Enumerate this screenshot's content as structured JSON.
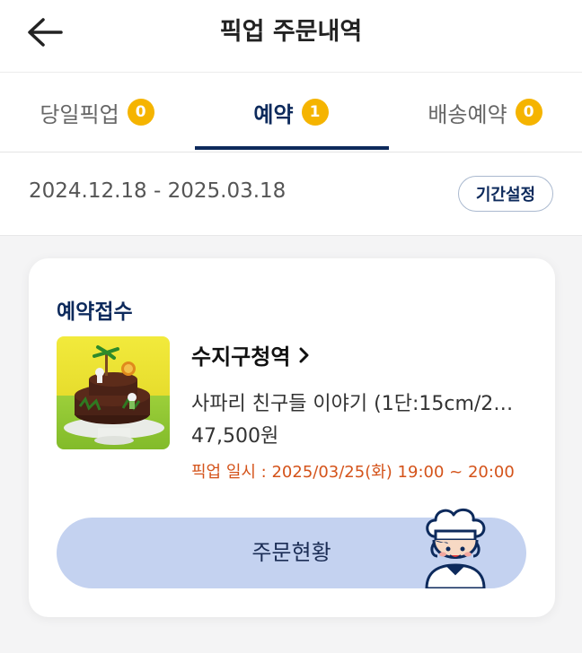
{
  "header": {
    "title": "픽업 주문내역"
  },
  "tabs": [
    {
      "label": "당일픽업",
      "count": "0",
      "active": false
    },
    {
      "label": "예약",
      "count": "1",
      "active": true
    },
    {
      "label": "배송예약",
      "count": "0",
      "active": false
    }
  ],
  "period": {
    "range": "2024.12.18 - 2025.03.18",
    "button": "기간설정"
  },
  "order": {
    "status": "예약접수",
    "store": "수지구청역",
    "product": "사파리 친구들 이야기 (1단:15cm/2…",
    "price": "47,500원",
    "pickup_time": "픽업 일시 : 2025/03/25(화) 19:00 ~ 20:00",
    "action_button": "주문현황"
  },
  "colors": {
    "navy": "#0d2a5c",
    "badge": "#f5b400",
    "pickup_text": "#d4531a",
    "action_button_bg": "#c4d2f0"
  },
  "icons": [
    "back-arrow-icon",
    "chevron-right-icon",
    "chef-mascot-icon"
  ]
}
